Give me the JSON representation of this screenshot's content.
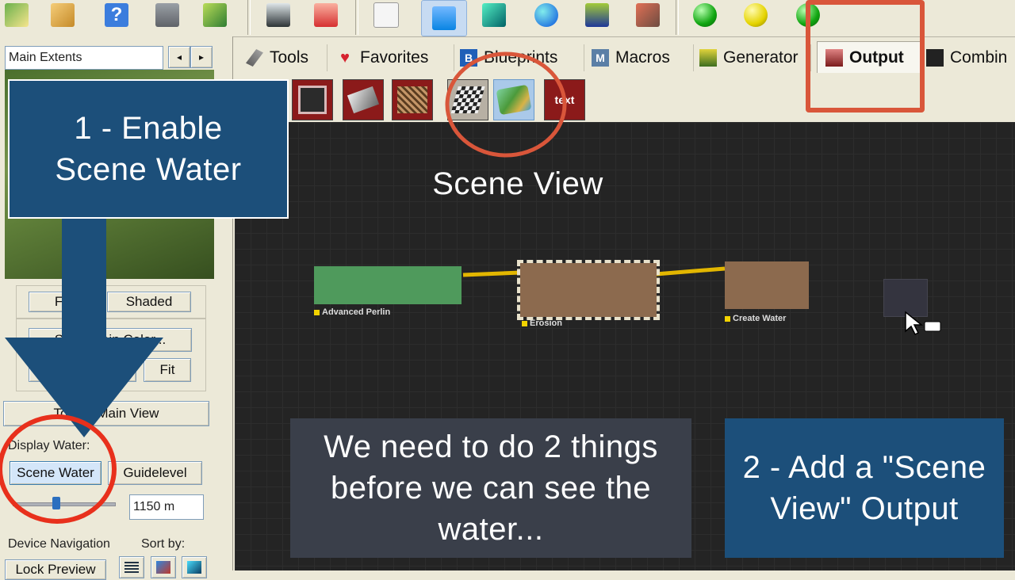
{
  "left_panel": {
    "extents_label": "Main Extents",
    "flat_label": "Flat",
    "shaded_label": "Shaded",
    "terrain_color_label": "Set Terrain Color...",
    "fit_label": "Fit",
    "toggle_label": "Toggle Main View",
    "display_water_label": "Display Water:",
    "scene_water_label": "Scene Water",
    "guidelevel_label": "Guidelevel",
    "water_level_value": "1150 m",
    "device_nav_label": "Device Navigation",
    "sort_by_label": "Sort by:",
    "lock_preview_label": "Lock Preview"
  },
  "tabs": [
    {
      "label": "Tools",
      "icon": "tools-icon"
    },
    {
      "label": "Favorites",
      "icon": "heart-icon"
    },
    {
      "label": "Blueprints",
      "icon": "blueprint-icon"
    },
    {
      "label": "Macros",
      "icon": "macro-icon"
    },
    {
      "label": "Generator",
      "icon": "generator-icon"
    },
    {
      "label": "Output",
      "icon": "output-icon"
    },
    {
      "label": "Combin",
      "icon": "combiner-icon"
    }
  ],
  "nodes": {
    "perlin": "Advanced Perlin",
    "erosion": "Erosion",
    "water": "Create Water"
  },
  "overlays": {
    "step1": "1 - Enable Scene Water",
    "scene_view": "Scene View",
    "explain": "We need to do 2 things before we can see the water...",
    "step2": "2 - Add a \"Scene View\" Output"
  },
  "colors": {
    "callout_blue": "#1c4f7a",
    "callout_gray": "#3a3f4a",
    "annotation_red": "#e8301c",
    "highlight_orange": "#d9563a",
    "perlin_green": "#4f9a5c",
    "node_brown": "#8c6a4e",
    "wire_yellow": "#e2b600"
  }
}
